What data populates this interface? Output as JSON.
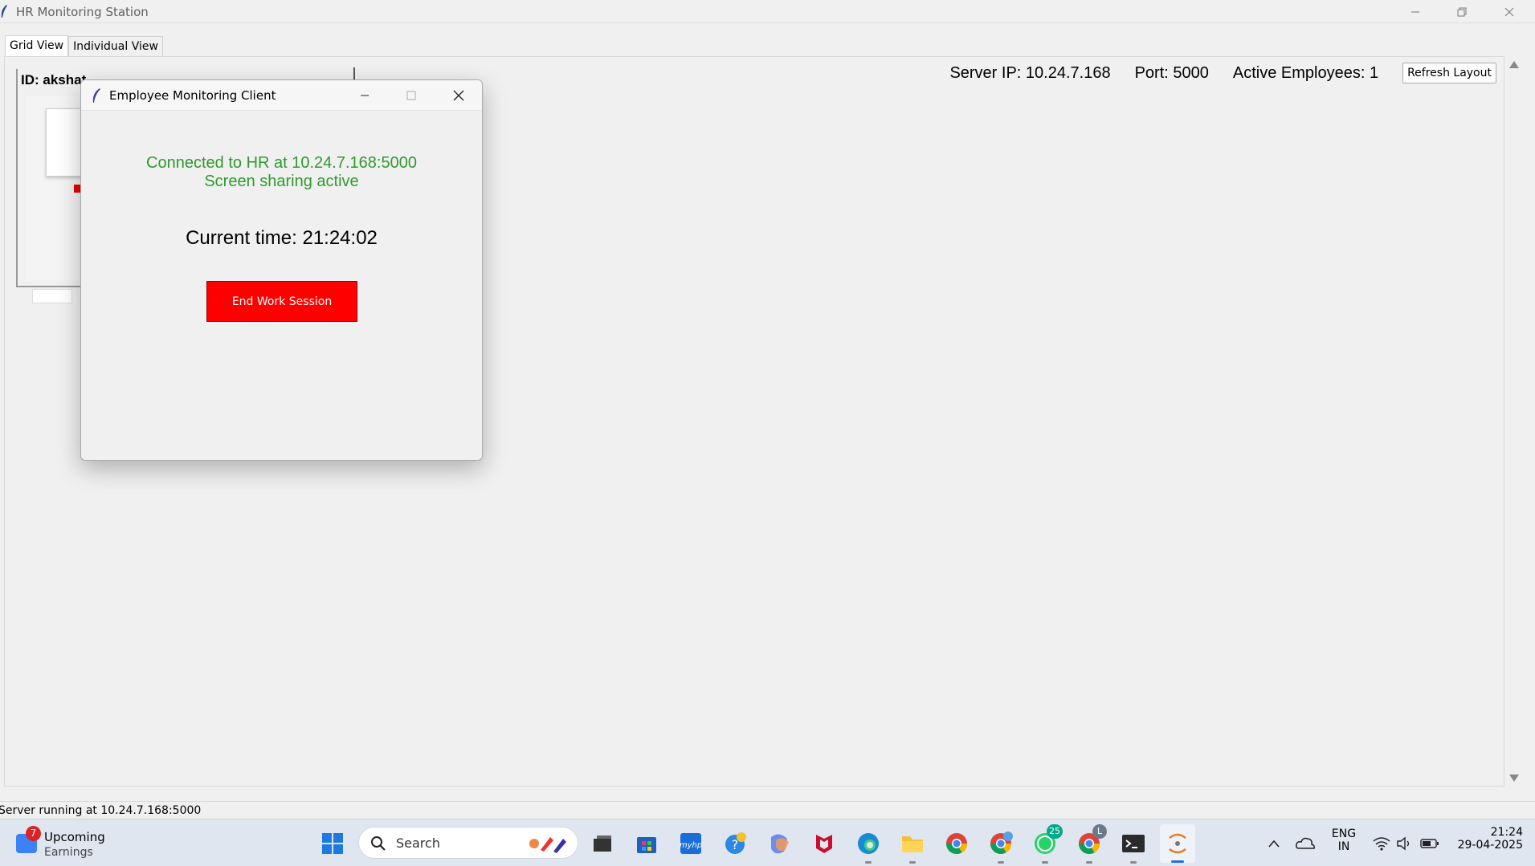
{
  "window": {
    "title": "HR Monitoring Station"
  },
  "tabs": [
    {
      "label": "Grid View",
      "active": true
    },
    {
      "label": "Individual View",
      "active": false
    }
  ],
  "info": {
    "server_ip": "Server IP: 10.24.7.168",
    "port": "Port: 5000",
    "active_employees": "Active Employees: 1",
    "refresh_label": "Refresh Layout"
  },
  "employee_card": {
    "id_label": "ID: akshat"
  },
  "client_dialog": {
    "title": "Employee Monitoring Client",
    "status_line1": "Connected to HR at 10.24.7.168:5000",
    "status_line2": "Screen sharing active",
    "time_text": "Current time: 21:24:02",
    "end_button": "End Work Session",
    "status_color": "#2e9a2e",
    "button_color": "#ff0000"
  },
  "statusbar": {
    "text": "Server running at 10.24.7.168:5000"
  },
  "taskbar": {
    "widget_title": "Upcoming",
    "widget_subtitle": "Earnings",
    "widget_badge": "7",
    "search_placeholder": "Search",
    "whatsapp_badge": "25",
    "chrome_profile_letter": "L",
    "language_line1": "ENG",
    "language_line2": "IN",
    "time": "21:24",
    "date": "29-04-2025",
    "icons": [
      "windows-start-icon",
      "search-icon",
      "file-manager-icon",
      "microsoft-store-icon",
      "myhp-icon",
      "help-icon",
      "copilot-icon",
      "mcafee-icon",
      "edge-icon",
      "folder-icon",
      "chrome-icon",
      "chrome-profile-icon",
      "whatsapp-icon",
      "chrome-profile-l-icon",
      "terminal-icon",
      "python-tk-icon"
    ]
  }
}
